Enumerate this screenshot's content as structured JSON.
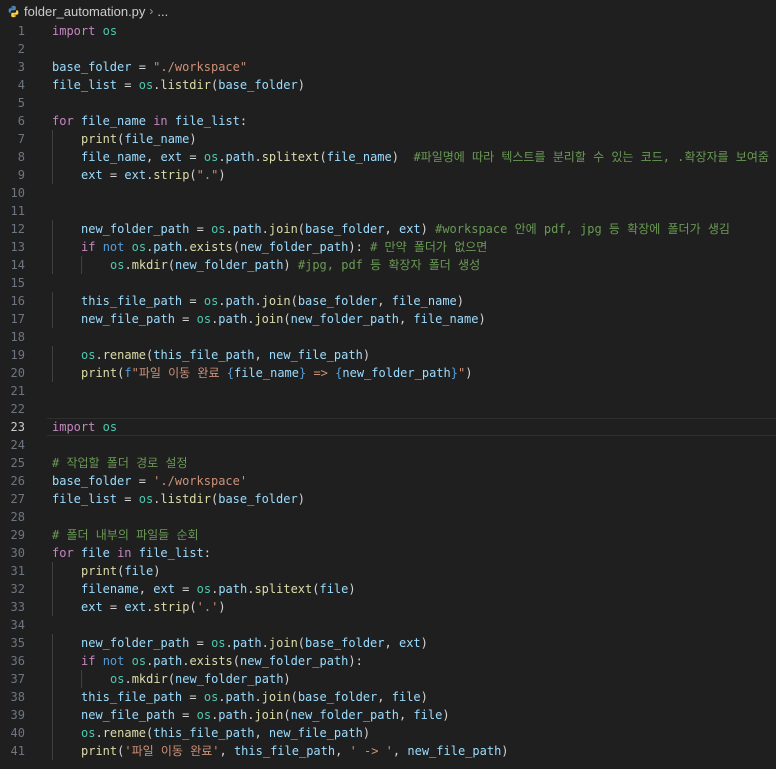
{
  "breadcrumb": {
    "file": "folder_automation.py",
    "more": "..."
  },
  "colors": {
    "background": "#1f1f1f",
    "keyword": "#c586c0",
    "variable": "#9cdcfe",
    "function": "#dcdcaa",
    "module": "#4ec9b0",
    "string": "#ce9178",
    "comment": "#6a9955",
    "line_number": "#6e7681"
  },
  "editor": {
    "current_line": 23,
    "lines": [
      {
        "n": "1",
        "indent": 0,
        "tokens": [
          {
            "t": "import",
            "c": "kw"
          },
          {
            "t": " "
          },
          {
            "t": "os",
            "c": "mod"
          }
        ]
      },
      {
        "n": "2",
        "indent": 0,
        "tokens": []
      },
      {
        "n": "3",
        "indent": 0,
        "tokens": [
          {
            "t": "base_folder",
            "c": "var"
          },
          {
            "t": " = "
          },
          {
            "t": "\"./workspace\"",
            "c": "str"
          }
        ]
      },
      {
        "n": "4",
        "indent": 0,
        "tokens": [
          {
            "t": "file_list",
            "c": "var"
          },
          {
            "t": " = "
          },
          {
            "t": "os",
            "c": "mod"
          },
          {
            "t": "."
          },
          {
            "t": "listdir",
            "c": "fn"
          },
          {
            "t": "("
          },
          {
            "t": "base_folder",
            "c": "var"
          },
          {
            "t": ")"
          }
        ]
      },
      {
        "n": "5",
        "indent": 0,
        "tokens": []
      },
      {
        "n": "6",
        "indent": 0,
        "tokens": [
          {
            "t": "for",
            "c": "kw"
          },
          {
            "t": " "
          },
          {
            "t": "file_name",
            "c": "var"
          },
          {
            "t": " "
          },
          {
            "t": "in",
            "c": "kw"
          },
          {
            "t": " "
          },
          {
            "t": "file_list",
            "c": "var"
          },
          {
            "t": ":"
          }
        ]
      },
      {
        "n": "7",
        "indent": 1,
        "tokens": [
          {
            "t": "print",
            "c": "fn"
          },
          {
            "t": "("
          },
          {
            "t": "file_name",
            "c": "var"
          },
          {
            "t": ")"
          }
        ]
      },
      {
        "n": "8",
        "indent": 1,
        "tokens": [
          {
            "t": "file_name",
            "c": "var"
          },
          {
            "t": ", "
          },
          {
            "t": "ext",
            "c": "var"
          },
          {
            "t": " = "
          },
          {
            "t": "os",
            "c": "mod"
          },
          {
            "t": "."
          },
          {
            "t": "path",
            "c": "var"
          },
          {
            "t": "."
          },
          {
            "t": "splitext",
            "c": "fn"
          },
          {
            "t": "("
          },
          {
            "t": "file_name",
            "c": "var"
          },
          {
            "t": ")  "
          },
          {
            "t": "#파일명에 따라 텍스트를 분리할 수 있는 코드, .확장자를 보여줌",
            "c": "com"
          }
        ]
      },
      {
        "n": "9",
        "indent": 1,
        "tokens": [
          {
            "t": "ext",
            "c": "var"
          },
          {
            "t": " = "
          },
          {
            "t": "ext",
            "c": "var"
          },
          {
            "t": "."
          },
          {
            "t": "strip",
            "c": "fn"
          },
          {
            "t": "("
          },
          {
            "t": "\".\"",
            "c": "str"
          },
          {
            "t": ")"
          }
        ]
      },
      {
        "n": "10",
        "indent": 1,
        "tokens": []
      },
      {
        "n": "11",
        "indent": 1,
        "tokens": []
      },
      {
        "n": "12",
        "indent": 1,
        "tokens": [
          {
            "t": "new_folder_path",
            "c": "var"
          },
          {
            "t": " = "
          },
          {
            "t": "os",
            "c": "mod"
          },
          {
            "t": "."
          },
          {
            "t": "path",
            "c": "var"
          },
          {
            "t": "."
          },
          {
            "t": "join",
            "c": "fn"
          },
          {
            "t": "("
          },
          {
            "t": "base_folder",
            "c": "var"
          },
          {
            "t": ", "
          },
          {
            "t": "ext",
            "c": "var"
          },
          {
            "t": ") "
          },
          {
            "t": "#workspace 안에 pdf, jpg 등 확장에 폴더가 생김",
            "c": "com"
          }
        ]
      },
      {
        "n": "13",
        "indent": 1,
        "tokens": [
          {
            "t": "if",
            "c": "kw"
          },
          {
            "t": " "
          },
          {
            "t": "not",
            "c": "kw2"
          },
          {
            "t": " "
          },
          {
            "t": "os",
            "c": "mod"
          },
          {
            "t": "."
          },
          {
            "t": "path",
            "c": "var"
          },
          {
            "t": "."
          },
          {
            "t": "exists",
            "c": "fn"
          },
          {
            "t": "("
          },
          {
            "t": "new_folder_path",
            "c": "var"
          },
          {
            "t": "): "
          },
          {
            "t": "# 만약 폴더가 없으면",
            "c": "com"
          }
        ]
      },
      {
        "n": "14",
        "indent": 2,
        "tokens": [
          {
            "t": "os",
            "c": "mod"
          },
          {
            "t": "."
          },
          {
            "t": "mkdir",
            "c": "fn"
          },
          {
            "t": "("
          },
          {
            "t": "new_folder_path",
            "c": "var"
          },
          {
            "t": ") "
          },
          {
            "t": "#jpg, pdf 등 확장자 폴더 생성",
            "c": "com"
          }
        ]
      },
      {
        "n": "15",
        "indent": 1,
        "tokens": []
      },
      {
        "n": "16",
        "indent": 1,
        "tokens": [
          {
            "t": "this_file_path",
            "c": "var"
          },
          {
            "t": " = "
          },
          {
            "t": "os",
            "c": "mod"
          },
          {
            "t": "."
          },
          {
            "t": "path",
            "c": "var"
          },
          {
            "t": "."
          },
          {
            "t": "join",
            "c": "fn"
          },
          {
            "t": "("
          },
          {
            "t": "base_folder",
            "c": "var"
          },
          {
            "t": ", "
          },
          {
            "t": "file_name",
            "c": "var"
          },
          {
            "t": ")"
          }
        ]
      },
      {
        "n": "17",
        "indent": 1,
        "tokens": [
          {
            "t": "new_file_path",
            "c": "var"
          },
          {
            "t": " = "
          },
          {
            "t": "os",
            "c": "mod"
          },
          {
            "t": "."
          },
          {
            "t": "path",
            "c": "var"
          },
          {
            "t": "."
          },
          {
            "t": "join",
            "c": "fn"
          },
          {
            "t": "("
          },
          {
            "t": "new_folder_path",
            "c": "var"
          },
          {
            "t": ", "
          },
          {
            "t": "file_name",
            "c": "var"
          },
          {
            "t": ")"
          }
        ]
      },
      {
        "n": "18",
        "indent": 1,
        "tokens": []
      },
      {
        "n": "19",
        "indent": 1,
        "tokens": [
          {
            "t": "os",
            "c": "mod"
          },
          {
            "t": "."
          },
          {
            "t": "rename",
            "c": "fn"
          },
          {
            "t": "("
          },
          {
            "t": "this_file_path",
            "c": "var"
          },
          {
            "t": ", "
          },
          {
            "t": "new_file_path",
            "c": "var"
          },
          {
            "t": ")"
          }
        ]
      },
      {
        "n": "20",
        "indent": 1,
        "tokens": [
          {
            "t": "print",
            "c": "fn"
          },
          {
            "t": "("
          },
          {
            "t": "f",
            "c": "kw2"
          },
          {
            "t": "\"파일 이동 완료 ",
            "c": "str"
          },
          {
            "t": "{",
            "c": "brace"
          },
          {
            "t": "file_name",
            "c": "var"
          },
          {
            "t": "}",
            "c": "brace"
          },
          {
            "t": " => ",
            "c": "str"
          },
          {
            "t": "{",
            "c": "brace"
          },
          {
            "t": "new_folder_path",
            "c": "var"
          },
          {
            "t": "}",
            "c": "brace"
          },
          {
            "t": "\"",
            "c": "str"
          },
          {
            "t": ")"
          }
        ]
      },
      {
        "n": "21",
        "indent": 0,
        "tokens": []
      },
      {
        "n": "22",
        "indent": 0,
        "tokens": []
      },
      {
        "n": "23",
        "indent": 0,
        "tokens": [
          {
            "t": "import",
            "c": "kw"
          },
          {
            "t": " "
          },
          {
            "t": "os",
            "c": "mod"
          }
        ]
      },
      {
        "n": "24",
        "indent": 0,
        "tokens": []
      },
      {
        "n": "25",
        "indent": 0,
        "tokens": [
          {
            "t": "# 작업할 폴더 경로 설정",
            "c": "com"
          }
        ]
      },
      {
        "n": "26",
        "indent": 0,
        "tokens": [
          {
            "t": "base_folder",
            "c": "var"
          },
          {
            "t": " = "
          },
          {
            "t": "'./workspace'",
            "c": "str"
          }
        ]
      },
      {
        "n": "27",
        "indent": 0,
        "tokens": [
          {
            "t": "file_list",
            "c": "var"
          },
          {
            "t": " = "
          },
          {
            "t": "os",
            "c": "mod"
          },
          {
            "t": "."
          },
          {
            "t": "listdir",
            "c": "fn"
          },
          {
            "t": "("
          },
          {
            "t": "base_folder",
            "c": "var"
          },
          {
            "t": ")"
          }
        ]
      },
      {
        "n": "28",
        "indent": 0,
        "tokens": []
      },
      {
        "n": "29",
        "indent": 0,
        "tokens": [
          {
            "t": "# 폴더 내부의 파일들 순회",
            "c": "com"
          }
        ]
      },
      {
        "n": "30",
        "indent": 0,
        "tokens": [
          {
            "t": "for",
            "c": "kw"
          },
          {
            "t": " "
          },
          {
            "t": "file",
            "c": "var"
          },
          {
            "t": " "
          },
          {
            "t": "in",
            "c": "kw"
          },
          {
            "t": " "
          },
          {
            "t": "file_list",
            "c": "var"
          },
          {
            "t": ":"
          }
        ]
      },
      {
        "n": "31",
        "indent": 1,
        "tokens": [
          {
            "t": "print",
            "c": "fn"
          },
          {
            "t": "("
          },
          {
            "t": "file",
            "c": "var"
          },
          {
            "t": ")"
          }
        ]
      },
      {
        "n": "32",
        "indent": 1,
        "tokens": [
          {
            "t": "filename",
            "c": "var"
          },
          {
            "t": ", "
          },
          {
            "t": "ext",
            "c": "var"
          },
          {
            "t": " = "
          },
          {
            "t": "os",
            "c": "mod"
          },
          {
            "t": "."
          },
          {
            "t": "path",
            "c": "var"
          },
          {
            "t": "."
          },
          {
            "t": "splitext",
            "c": "fn"
          },
          {
            "t": "("
          },
          {
            "t": "file",
            "c": "var"
          },
          {
            "t": ")"
          }
        ]
      },
      {
        "n": "33",
        "indent": 1,
        "tokens": [
          {
            "t": "ext",
            "c": "var"
          },
          {
            "t": " = "
          },
          {
            "t": "ext",
            "c": "var"
          },
          {
            "t": "."
          },
          {
            "t": "strip",
            "c": "fn"
          },
          {
            "t": "("
          },
          {
            "t": "'.'",
            "c": "str"
          },
          {
            "t": ")"
          }
        ]
      },
      {
        "n": "34",
        "indent": 1,
        "tokens": []
      },
      {
        "n": "35",
        "indent": 1,
        "tokens": [
          {
            "t": "new_folder_path",
            "c": "var"
          },
          {
            "t": " = "
          },
          {
            "t": "os",
            "c": "mod"
          },
          {
            "t": "."
          },
          {
            "t": "path",
            "c": "var"
          },
          {
            "t": "."
          },
          {
            "t": "join",
            "c": "fn"
          },
          {
            "t": "("
          },
          {
            "t": "base_folder",
            "c": "var"
          },
          {
            "t": ", "
          },
          {
            "t": "ext",
            "c": "var"
          },
          {
            "t": ")"
          }
        ]
      },
      {
        "n": "36",
        "indent": 1,
        "tokens": [
          {
            "t": "if",
            "c": "kw"
          },
          {
            "t": " "
          },
          {
            "t": "not",
            "c": "kw2"
          },
          {
            "t": " "
          },
          {
            "t": "os",
            "c": "mod"
          },
          {
            "t": "."
          },
          {
            "t": "path",
            "c": "var"
          },
          {
            "t": "."
          },
          {
            "t": "exists",
            "c": "fn"
          },
          {
            "t": "("
          },
          {
            "t": "new_folder_path",
            "c": "var"
          },
          {
            "t": "):"
          }
        ]
      },
      {
        "n": "37",
        "indent": 2,
        "tokens": [
          {
            "t": "os",
            "c": "mod"
          },
          {
            "t": "."
          },
          {
            "t": "mkdir",
            "c": "fn"
          },
          {
            "t": "("
          },
          {
            "t": "new_folder_path",
            "c": "var"
          },
          {
            "t": ")"
          }
        ]
      },
      {
        "n": "38",
        "indent": 1,
        "tokens": [
          {
            "t": "this_file_path",
            "c": "var"
          },
          {
            "t": " = "
          },
          {
            "t": "os",
            "c": "mod"
          },
          {
            "t": "."
          },
          {
            "t": "path",
            "c": "var"
          },
          {
            "t": "."
          },
          {
            "t": "join",
            "c": "fn"
          },
          {
            "t": "("
          },
          {
            "t": "base_folder",
            "c": "var"
          },
          {
            "t": ", "
          },
          {
            "t": "file",
            "c": "var"
          },
          {
            "t": ")"
          }
        ]
      },
      {
        "n": "39",
        "indent": 1,
        "tokens": [
          {
            "t": "new_file_path",
            "c": "var"
          },
          {
            "t": " = "
          },
          {
            "t": "os",
            "c": "mod"
          },
          {
            "t": "."
          },
          {
            "t": "path",
            "c": "var"
          },
          {
            "t": "."
          },
          {
            "t": "join",
            "c": "fn"
          },
          {
            "t": "("
          },
          {
            "t": "new_folder_path",
            "c": "var"
          },
          {
            "t": ", "
          },
          {
            "t": "file",
            "c": "var"
          },
          {
            "t": ")"
          }
        ]
      },
      {
        "n": "40",
        "indent": 1,
        "tokens": [
          {
            "t": "os",
            "c": "mod"
          },
          {
            "t": "."
          },
          {
            "t": "rename",
            "c": "fn"
          },
          {
            "t": "("
          },
          {
            "t": "this_file_path",
            "c": "var"
          },
          {
            "t": ", "
          },
          {
            "t": "new_file_path",
            "c": "var"
          },
          {
            "t": ")"
          }
        ]
      },
      {
        "n": "41",
        "indent": 1,
        "tokens": [
          {
            "t": "print",
            "c": "fn"
          },
          {
            "t": "("
          },
          {
            "t": "'파일 이동 완료'",
            "c": "str"
          },
          {
            "t": ", "
          },
          {
            "t": "this_file_path",
            "c": "var"
          },
          {
            "t": ", "
          },
          {
            "t": "' -> '",
            "c": "str"
          },
          {
            "t": ", "
          },
          {
            "t": "new_file_path",
            "c": "var"
          },
          {
            "t": ")"
          }
        ]
      }
    ]
  }
}
